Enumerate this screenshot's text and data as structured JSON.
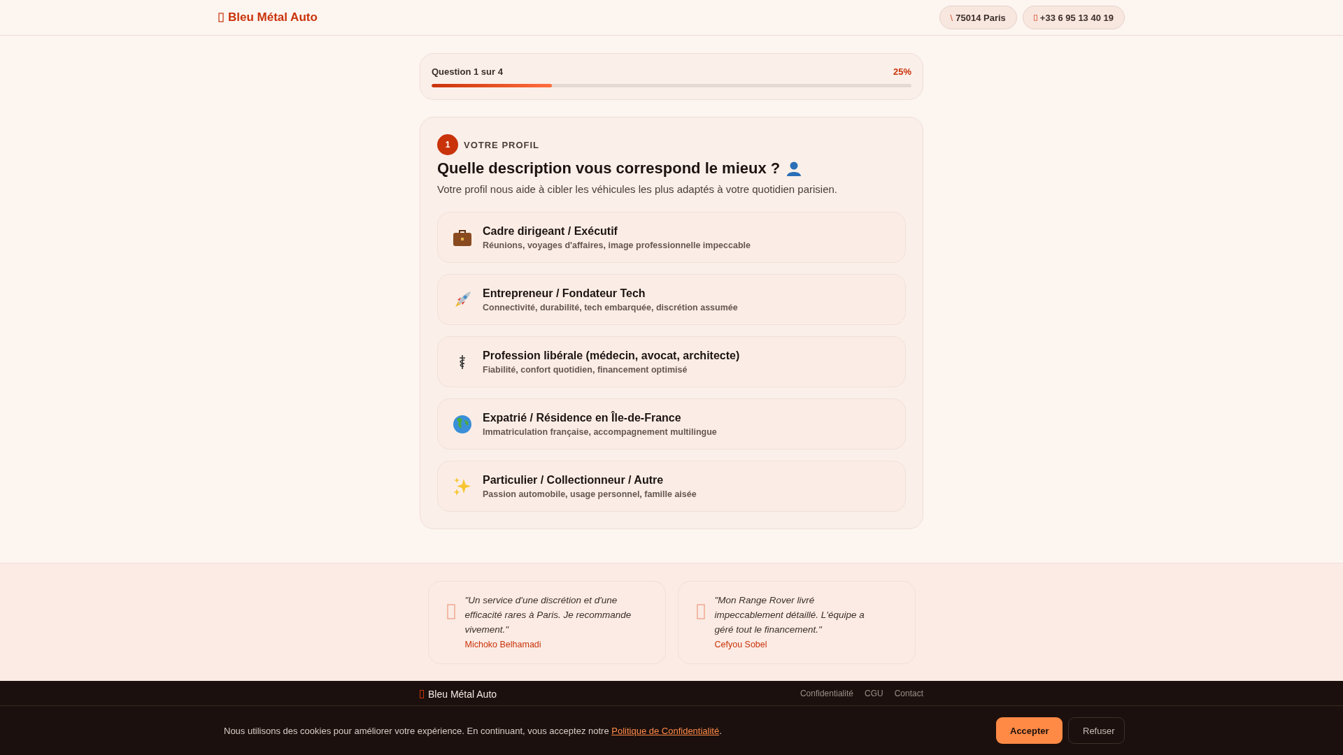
{
  "header": {
    "brand": "Bleu Métal Auto",
    "pills": [
      {
        "icon": "\\",
        "label": "75014 Paris",
        "kind": "text"
      },
      {
        "label": "+33 6 95 13 40 19",
        "kind": "glyph"
      }
    ]
  },
  "progress": {
    "label": "Question 1 sur 4",
    "percent": "25%",
    "level": 0.25
  },
  "question": {
    "number": "1",
    "section": "VOTRE PROFIL",
    "title": "Quelle description vous correspond le mieux ?",
    "subtitle": "Votre profil nous aide à cibler les véhicules les plus adaptés à votre quotidien parisien.",
    "options": [
      {
        "kind": "briefcase",
        "title": "Cadre dirigeant / Exécutif",
        "desc": "Réunions, voyages d'affaires, image professionnelle impeccable"
      },
      {
        "kind": "rocket",
        "title": "Entrepreneur / Fondateur Tech",
        "desc": "Connectivité, durabilité, tech embarquée, discrétion assumée"
      },
      {
        "kind": "caduceus",
        "title": "Profession libérale (médecin, avocat, architecte)",
        "desc": "Fiabilité, confort quotidien, financement optimisé"
      },
      {
        "kind": "globe",
        "title": "Expatrié / Résidence en Île-de-France",
        "desc": "Immatriculation française, accompagnement multilingue"
      },
      {
        "kind": "sparkles",
        "title": "Particulier / Collectionneur / Autre",
        "desc": "Passion automobile, usage personnel, famille aisée"
      }
    ]
  },
  "testimonials": [
    {
      "quote": "\"Un service d'une discrétion et d'une efficacité rares à Paris. Je recommande vivement.\"",
      "author": "Michoko Belhamadi"
    },
    {
      "quote": "\"Mon Range Rover livré impeccablement détaillé. L'équipe a géré tout le financement.\"",
      "author": "Cefyou Sobel"
    }
  ],
  "footer": {
    "brand": "Bleu Métal Auto",
    "links": [
      "Confidentialité",
      "CGU",
      "Contact"
    ]
  },
  "cookie_banner": {
    "text": "Nous utilisons des cookies pour améliorer votre expérience. En continuant, vous acceptez notre ",
    "link": "Politique de Confidentialité",
    "after": ".",
    "buttons": [
      {
        "label": "Accepter",
        "kind": "primary"
      },
      {
        "label": "Refuser",
        "kind": "secondary"
      }
    ]
  }
}
